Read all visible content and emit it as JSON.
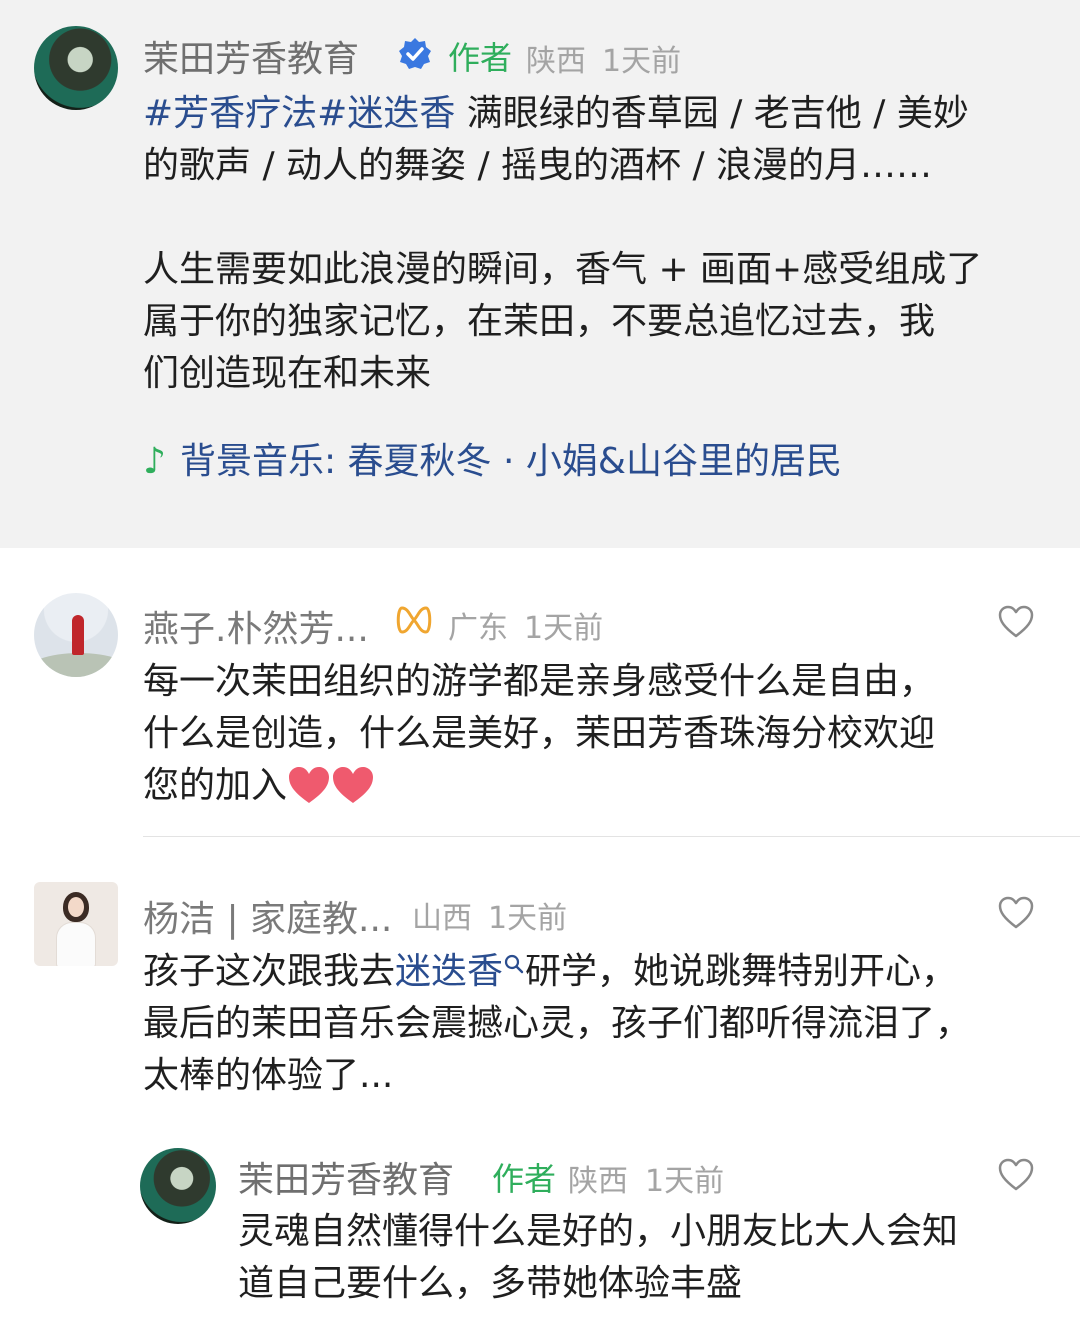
{
  "post": {
    "author": "茉田芳香教育",
    "author_tag": "作者",
    "location": "陕西",
    "time": "1天前",
    "topic1": "#芳香疗法",
    "topic2": "#迷迭香",
    "line1_rest": " 满眼绿的香草园 / 老吉他 / 美妙",
    "line2": "的歌声 / 动人的舞姿 / 摇曳的酒杯 / 浪漫的月……",
    "para2_line1": "人生需要如此浪漫的瞬间，香气 + 画面+感受组成了",
    "para2_line2": "属于你的独家记忆，在茉田，不要总追忆过去，我",
    "para2_line3": "们创造现在和未来",
    "music_label": "背景音乐: 春夏秋冬 · 小娟&山谷里的居民",
    "music_icon": "music-note-icon",
    "verified_icon": "verified-badge-icon"
  },
  "comments": [
    {
      "name": "燕子.朴然芳...",
      "location": "广东",
      "time": "1天前",
      "badge_icon": "infinity-badge-icon",
      "line1": "每一次茉田组织的游学都是亲身感受什么是自由，",
      "line2": "什么是创造，什么是美好，茉田芳香珠海分校欢迎",
      "line3": "您的加入"
    },
    {
      "name": "杨洁 | 家庭教...",
      "location": "山西",
      "time": "1天前",
      "line1_pre": "孩子这次跟我去",
      "line1_link": "迷迭香",
      "line1_post": "研学，她说跳舞特别开心，",
      "line2": "最后的茉田音乐会震撼心灵，孩子们都听得流泪了，",
      "line3": "太棒的体验了..."
    }
  ],
  "reply": {
    "name": "茉田芳香教育",
    "author_tag": "作者",
    "location": "陕西",
    "time": "1天前",
    "line1": "灵魂自然懂得什么是好的，小朋友比大人会知",
    "line2": "道自己要什么，多带她体验丰盛"
  },
  "colors": {
    "topic_blue": "#2a4d8f",
    "author_green": "#2fae5c",
    "post_bg": "#f2f2f2"
  }
}
